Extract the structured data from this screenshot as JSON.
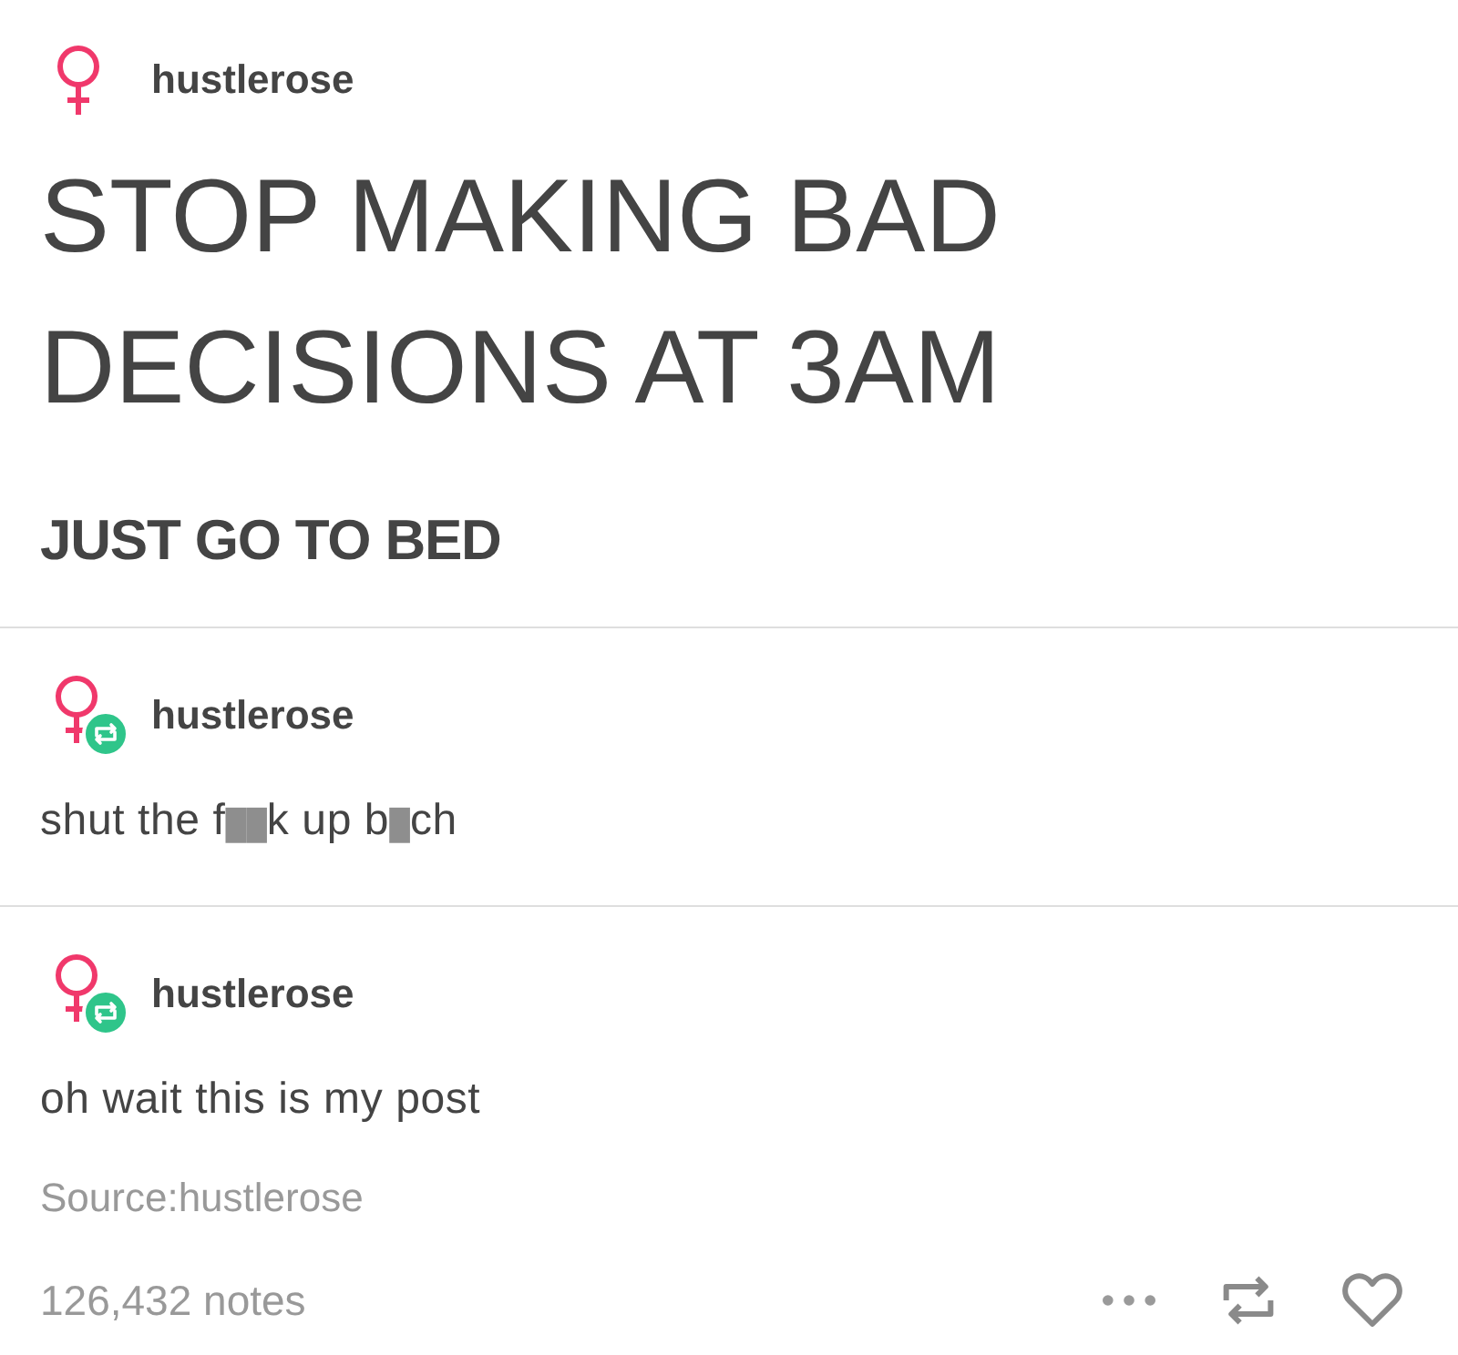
{
  "post": {
    "author": {
      "username": "hustlerose"
    },
    "title": "STOP MAKING BAD DECISIONS AT 3AM",
    "subtitle": "JUST GO TO BED"
  },
  "reblogs": [
    {
      "username": "hustlerose",
      "reblogged": true,
      "segments": [
        {
          "kind": "text",
          "text": "shut the f"
        },
        {
          "kind": "censored",
          "text": "██"
        },
        {
          "kind": "text",
          "text": "k up b"
        },
        {
          "kind": "censored",
          "text": "█"
        },
        {
          "kind": "text",
          "text": "ch"
        }
      ]
    },
    {
      "username": "hustlerose",
      "reblogged": true,
      "segments": [
        {
          "kind": "text",
          "text": "oh wait this is my post"
        }
      ]
    }
  ],
  "source": "Source:hustlerose",
  "footer": {
    "notes": "126,432 notes",
    "actions": [
      {
        "kind": "more"
      },
      {
        "kind": "reblog"
      },
      {
        "kind": "like",
        "liked": false
      }
    ]
  }
}
